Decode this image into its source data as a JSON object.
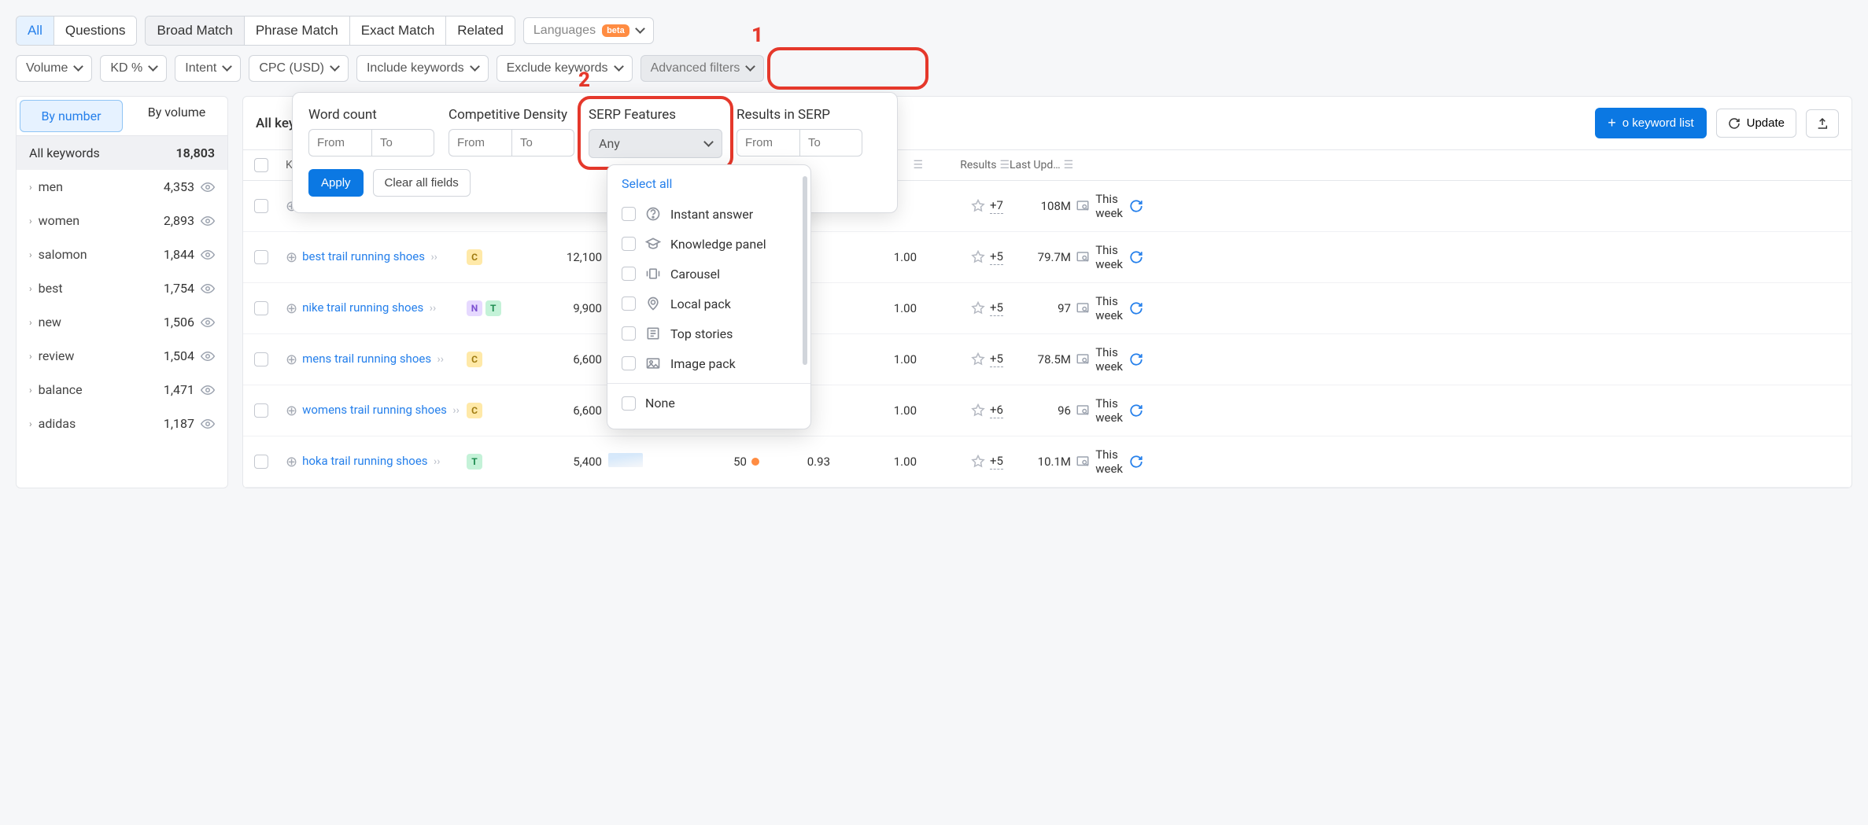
{
  "annotations": {
    "one": "1",
    "two": "2"
  },
  "top_tabs_a": {
    "all": "All",
    "questions": "Questions"
  },
  "top_tabs_b": {
    "broad": "Broad Match",
    "phrase": "Phrase Match",
    "exact": "Exact Match",
    "related": "Related"
  },
  "languages": {
    "label": "Languages",
    "badge": "beta"
  },
  "filters_row2": {
    "volume": "Volume",
    "kd": "KD %",
    "intent": "Intent",
    "cpc": "CPC (USD)",
    "include": "Include keywords",
    "exclude": "Exclude keywords",
    "advanced": "Advanced filters"
  },
  "adv_panel": {
    "word_count": "Word count",
    "comp_density": "Competitive Density",
    "serp_features": "SERP Features",
    "results_serp": "Results in SERP",
    "from": "From",
    "to": "To",
    "any": "Any",
    "apply": "Apply",
    "clear": "Clear all fields"
  },
  "serp_features_list": {
    "select_all": "Select all",
    "items": [
      {
        "label": "Instant answer",
        "icon": "question"
      },
      {
        "label": "Knowledge panel",
        "icon": "grad"
      },
      {
        "label": "Carousel",
        "icon": "carousel"
      },
      {
        "label": "Local pack",
        "icon": "pin"
      },
      {
        "label": "Top stories",
        "icon": "news"
      },
      {
        "label": "Image pack",
        "icon": "image"
      }
    ],
    "none": "None"
  },
  "sidebar": {
    "tab_number": "By number",
    "tab_volume": "By volume",
    "all_label": "All keywords",
    "all_count": "18,803",
    "items": [
      {
        "label": "men",
        "count": "4,353"
      },
      {
        "label": "women",
        "count": "2,893"
      },
      {
        "label": "salomon",
        "count": "1,844"
      },
      {
        "label": "best",
        "count": "1,754"
      },
      {
        "label": "new",
        "count": "1,506"
      },
      {
        "label": "review",
        "count": "1,504"
      },
      {
        "label": "balance",
        "count": "1,471"
      },
      {
        "label": "adidas",
        "count": "1,187"
      }
    ]
  },
  "table": {
    "title_trunc": "All keyw",
    "add_btn": "o keyword list",
    "update": "Update",
    "cols": {
      "keyword": "Ke",
      "intent": "",
      "volume": "",
      "trend": "",
      "kd": "",
      "cpc": "",
      "com": "",
      "sf": "",
      "results": "Results",
      "last": "Last Upd…"
    },
    "rows": [
      {
        "kw": "",
        "intents": [],
        "vol": "",
        "kd": "",
        "cpc": "",
        "com": "",
        "sf": "+7",
        "results": "108M",
        "last": "This week"
      },
      {
        "kw": "best trail running shoes",
        "intents": [
          "C"
        ],
        "vol": "12,100",
        "kd": "",
        "cpc": "",
        "com": "1.00",
        "sf": "+5",
        "results": "79.7M",
        "last": "This week"
      },
      {
        "kw": "nike trail running shoes",
        "intents": [
          "N",
          "T"
        ],
        "vol": "9,900",
        "kd": "",
        "cpc": "",
        "com": "1.00",
        "sf": "+5",
        "results": "97",
        "last": "This week"
      },
      {
        "kw": "mens trail running shoes",
        "intents": [
          "C"
        ],
        "vol": "6,600",
        "kd": "",
        "cpc": "",
        "com": "1.00",
        "sf": "+5",
        "results": "78.5M",
        "last": "This week"
      },
      {
        "kw": "womens trail running shoes",
        "intents": [
          "C"
        ],
        "vol": "6,600",
        "kd": "",
        "cpc": "",
        "com": "1.00",
        "sf": "+6",
        "results": "96",
        "last": "This week"
      },
      {
        "kw": "hoka trail running shoes",
        "intents": [
          "T"
        ],
        "vol": "5,400",
        "kd": "50",
        "cpc": "0.93",
        "com": "1.00",
        "sf": "+5",
        "results": "10.1M",
        "last": "This week",
        "has_kd": true,
        "has_trend": true
      }
    ]
  }
}
